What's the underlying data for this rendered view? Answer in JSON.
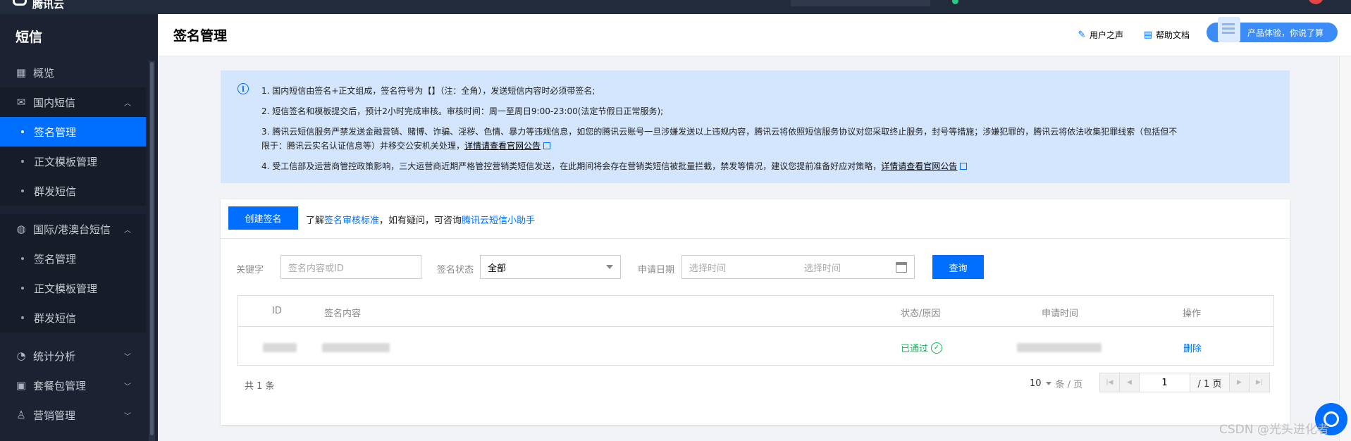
{
  "topbar": {
    "brand": "腾讯云"
  },
  "sidebar": {
    "title": "短信",
    "overview": "概览",
    "domestic": {
      "label": "国内短信",
      "items": [
        "签名管理",
        "正文模板管理",
        "群发短信"
      ]
    },
    "international": {
      "label": "国际/港澳台短信",
      "items": [
        "签名管理",
        "正文模板管理",
        "群发短信"
      ]
    },
    "stats": "统计分析",
    "packages": "套餐包管理",
    "marketing": "营销管理"
  },
  "header": {
    "title": "签名管理",
    "user_voice": "用户之声",
    "help_docs": "帮助文档",
    "promo": "产品体验，你说了算"
  },
  "notice": {
    "line1": "1. 国内短信由签名+正文组成，签名符号为【】（注：全角），发送短信内容时必须带签名;",
    "line2": "2. 短信签名和模板提交后，预计2小时完成审核。审核时间：周一至周日9:00-23:00(法定节假日正常服务);",
    "line3a": "3. 腾讯云短信服务严禁发送金融营销、赌博、诈骗、淫秽、色情、暴力等违规信息，如您的腾讯云账号一旦涉嫌发送以上违规内容，腾讯云将依照短信服务协议对您采取终止服务，封号等措施；涉嫌犯罪的，腾讯云将依法收集犯罪线索（包括但不",
    "line3b": "限于：腾讯云实名认证信息等）并移交公安机关处理，",
    "line3_link": "详情请查看官网公告",
    "line4": "4. 受工信部及运营商管控政策影响，三大运营商近期严格管控营销类短信发送，在此期间将会存在营销类短信被批量拦截，禁发等情况，建议您提前准备好应对策略，",
    "line4_link": "详情请查看官网公告"
  },
  "toolbar": {
    "create_button": "创建签名",
    "tip_prefix": "了解",
    "tip_link1": "签名审核标准",
    "tip_mid": "，如有疑问，可咨询",
    "tip_link2": "腾讯云短信小助手"
  },
  "filters": {
    "keyword_label": "关键字",
    "keyword_placeholder": "签名内容或ID",
    "status_label": "签名状态",
    "status_value": "全部",
    "date_label": "申请日期",
    "date_start_placeholder": "选择时间",
    "date_end_placeholder": "选择时间",
    "query_button": "查询"
  },
  "table": {
    "columns": [
      "ID",
      "签名内容",
      "状态/原因",
      "申请时间",
      "操作"
    ],
    "rows": [
      {
        "status": "已通过",
        "action": "删除"
      }
    ]
  },
  "pagination": {
    "total": "共 1 条",
    "page_size": "10",
    "page_size_unit": "条 / 页",
    "current_page": "1",
    "total_pages": "/ 1 页"
  },
  "watermark": "CSDN @光头进化者"
}
